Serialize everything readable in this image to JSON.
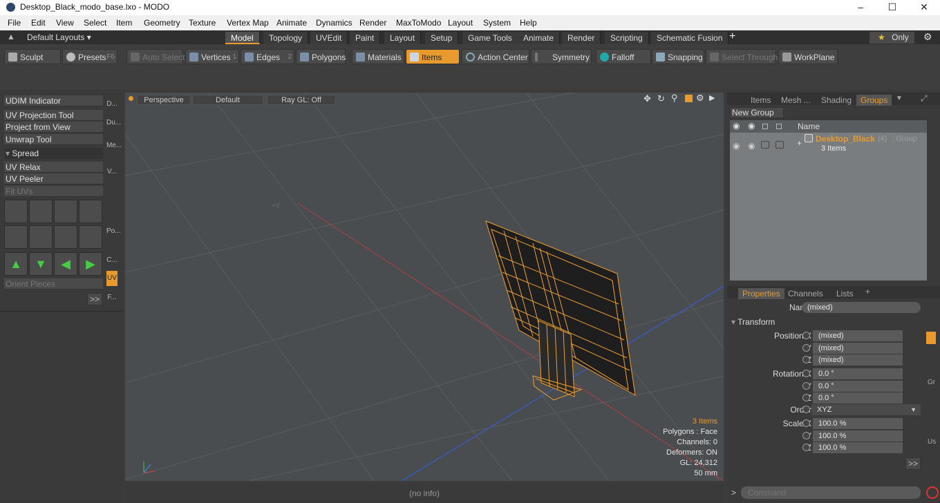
{
  "window": {
    "title": "Desktop_Black_modo_base.lxo - MODO"
  },
  "menu": [
    "File",
    "Edit",
    "View",
    "Select",
    "Item",
    "Geometry",
    "Texture",
    "Vertex Map",
    "Animate",
    "Dynamics",
    "Render",
    "MaxToModo",
    "Layout",
    "System",
    "Help"
  ],
  "layouts": {
    "label": "Default Layouts"
  },
  "tabs": [
    "Model",
    "Topology",
    "UVEdit",
    "Paint",
    "Layout",
    "Setup",
    "Game Tools",
    "Animate",
    "Render",
    "Scripting",
    "Schematic Fusion"
  ],
  "only": "Only",
  "toolbar": {
    "sculpt": "Sculpt",
    "presets": "Presets",
    "presets_key": "F6",
    "auto_select": "Auto Select",
    "vertices": "Vertices",
    "vertices_key": "1",
    "edges": "Edges",
    "edges_key": "2",
    "polygons": "Polygons",
    "materials": "Materials",
    "items": "Items",
    "action_center": "Action Center",
    "symmetry": "Symmetry",
    "falloff": "Falloff",
    "snapping": "Snapping",
    "select_through": "Select Through",
    "workplane": "WorkPlane"
  },
  "left": {
    "items": [
      "UDIM Indicator",
      "UV Projection Tool",
      "Project from View",
      "Unwrap Tool"
    ],
    "spread": "Spread",
    "items2": [
      "UV Relax",
      "UV Peeler"
    ],
    "fit": "Fit UVs",
    "orient": "Orient Pieces",
    "more": ">>",
    "vtabs": [
      "D...",
      "Du...",
      "Me...",
      "V...",
      "Po...",
      "C...",
      "UV",
      "F..."
    ]
  },
  "viewport": {
    "view": "Perspective",
    "shading": "Default",
    "raygl": "Ray GL: Off",
    "info": [
      "3 Items",
      "Polygons : Face",
      "Channels: 0",
      "Deformers: ON",
      "GL: 24,312",
      "50 mm"
    ]
  },
  "status": "(no info)",
  "scene": {
    "tabs": [
      "Items",
      "Mesh ...",
      "Shading",
      "Groups"
    ],
    "new_group": "New Group",
    "col_name": "Name",
    "group_name": "Desktop_Black",
    "group_count": "(4)",
    "group_type": ": Group",
    "group_items": "3 Items"
  },
  "props": {
    "tabs": [
      "Properties",
      "Channels",
      "Lists"
    ],
    "name_label": "Name",
    "name_value": "(mixed)",
    "transform": "Transform",
    "position_label": "Position X",
    "rotation_label": "Rotation X",
    "order_label": "Order",
    "scale_label": "Scale X",
    "position": [
      "(mixed)",
      "(mixed)",
      "(mixed)"
    ],
    "rotation": [
      "0.0 °",
      "0.0 °",
      "0.0 °"
    ],
    "order": "XYZ",
    "scale": [
      "100.0 %",
      "100.0 %",
      "100.0 %"
    ],
    "more": ">>"
  },
  "command": {
    "placeholder": "Command"
  },
  "colors": {
    "accent": "#e99a2c",
    "viewport_bg": "#4a4d50"
  }
}
